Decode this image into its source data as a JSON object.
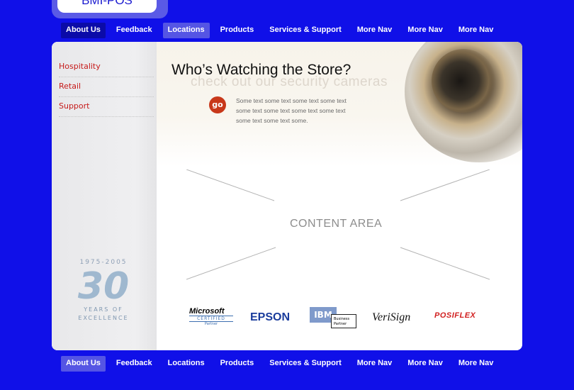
{
  "brand": {
    "logo_text": "BMI-POS"
  },
  "nav_top": [
    {
      "label": "About Us"
    },
    {
      "label": "Feedback"
    },
    {
      "label": "Locations"
    },
    {
      "label": "Products"
    },
    {
      "label": "Services & Support"
    },
    {
      "label": "More Nav"
    },
    {
      "label": "More Nav"
    },
    {
      "label": "More Nav"
    }
  ],
  "nav_bottom": [
    {
      "label": "About Us"
    },
    {
      "label": "Feedback"
    },
    {
      "label": "Locations"
    },
    {
      "label": "Products"
    },
    {
      "label": "Services & Support"
    },
    {
      "label": "More Nav"
    },
    {
      "label": "More Nav"
    },
    {
      "label": "More Nav"
    }
  ],
  "sidebar": {
    "items": [
      {
        "label": "Hospitality"
      },
      {
        "label": "Retail"
      },
      {
        "label": "Support"
      }
    ],
    "anniversary": {
      "years": "1975-2005",
      "number": "30",
      "line1": "YEARS OF",
      "line2": "EXCELLENCE"
    }
  },
  "hero": {
    "title": "Who’s Watching the Store?",
    "subtitle": "check out our security cameras",
    "go_label": "go",
    "body": "Some text some text some text some text some text some text some text some text some text some text some."
  },
  "content": {
    "placeholder": "CONTENT AREA"
  },
  "partners": {
    "microsoft_1": "Microsoft",
    "microsoft_2": "CERTIFIED",
    "microsoft_3": "Partner",
    "epson": "EPSON",
    "ibm": "IBM",
    "ibm_bp1": "Business",
    "ibm_bp2": "Partner",
    "verisign": "VeriSign",
    "posiflex": "POSIFLEX"
  },
  "colors": {
    "background": "#1010e8",
    "nav_active": "#5555e4",
    "sidebar_link": "#c61a1a",
    "go_button": "#c8381a"
  }
}
